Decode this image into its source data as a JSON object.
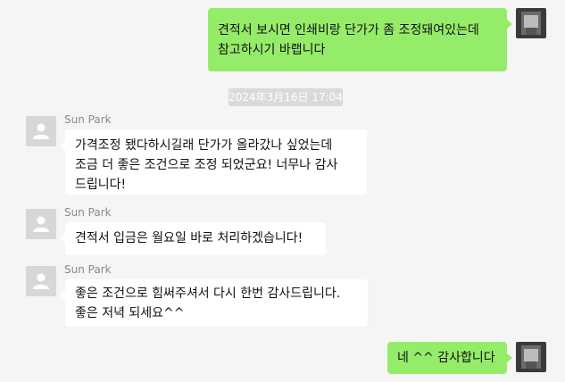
{
  "messages": [
    {
      "lines": [
        "견적서 보시면 인쇄비랑 단가가 좀 조정돼여있는데",
        "참고하시기 바랩니다"
      ]
    },
    {
      "sender": "Sun Park",
      "lines": [
        "가격조정 됐다하시길래 단가가 올라갔나 싶었는데",
        "조금 더 좋은 조건으로 조정 되었군요!  너무나 감사",
        "드립니다!"
      ]
    },
    {
      "sender": "Sun Park",
      "lines": [
        "견적서 입금은 월요일 바로 처리하겠습니다!"
      ]
    },
    {
      "sender": "Sun Park",
      "lines": [
        "좋은 조건으로 힘써주셔서 다시 한번 감사드립니다.",
        "좋은 저녁 되세요^^"
      ]
    },
    {
      "lines": [
        "네 ^^ 감사합니다"
      ]
    }
  ],
  "timestamp": "2024年3月16日 17:04",
  "colors": {
    "outgoing": "#95ec69",
    "incoming": "#ffffff",
    "background": "#f5f5f5"
  }
}
